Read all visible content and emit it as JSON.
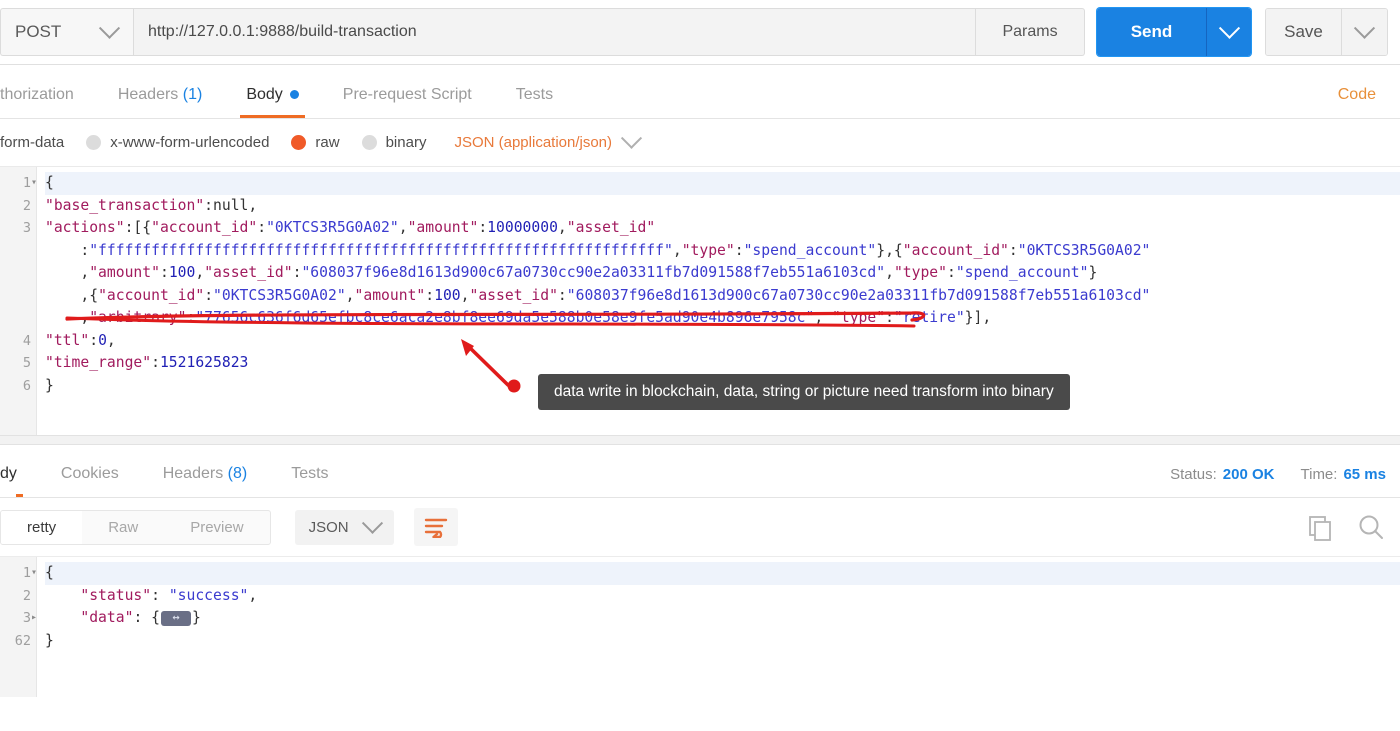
{
  "request_bar": {
    "method": "POST",
    "url": "http://127.0.0.1:9888/build-transaction",
    "params_label": "Params",
    "send_label": "Send",
    "save_label": "Save"
  },
  "request_tabs": {
    "items": [
      {
        "label": "thorization",
        "count": "",
        "active": false
      },
      {
        "label": "Headers",
        "count": "(1)",
        "active": false
      },
      {
        "label": "Body",
        "count": "",
        "active": true
      },
      {
        "label": "Pre-request Script",
        "count": "",
        "active": false
      },
      {
        "label": "Tests",
        "count": "",
        "active": false
      }
    ],
    "code_link": "Code"
  },
  "body_type": {
    "options": [
      {
        "label": "form-data",
        "selected": false,
        "has_radio": false
      },
      {
        "label": "x-www-form-urlencoded",
        "selected": false,
        "has_radio": true
      },
      {
        "label": "raw",
        "selected": true,
        "has_radio": true
      },
      {
        "label": "binary",
        "selected": false,
        "has_radio": true
      }
    ],
    "format": "JSON (application/json)"
  },
  "request_body": {
    "line_numbers": [
      "1",
      "2",
      "3",
      "",
      "",
      "",
      "",
      "4",
      "5",
      "6"
    ],
    "lines": [
      {
        "n": "1",
        "fold": true,
        "segments": [
          {
            "t": "{",
            "c": "p"
          }
        ]
      },
      {
        "n": "2",
        "segments": [
          {
            "t": "\"base_transaction\"",
            "c": "k"
          },
          {
            "t": ":",
            "c": "p"
          },
          {
            "t": "null",
            "c": "nul"
          },
          {
            "t": ",",
            "c": "p"
          }
        ]
      },
      {
        "n": "3",
        "segments": [
          {
            "t": "\"actions\"",
            "c": "k"
          },
          {
            "t": ":[{",
            "c": "p"
          },
          {
            "t": "\"account_id\"",
            "c": "k"
          },
          {
            "t": ":",
            "c": "p"
          },
          {
            "t": "\"0KTCS3R5G0A02\"",
            "c": "s"
          },
          {
            "t": ",",
            "c": "p"
          },
          {
            "t": "\"amount\"",
            "c": "k"
          },
          {
            "t": ":",
            "c": "p"
          },
          {
            "t": "10000000",
            "c": "n"
          },
          {
            "t": ",",
            "c": "p"
          },
          {
            "t": "\"asset_id\"",
            "c": "k"
          }
        ]
      },
      {
        "n": "",
        "indent": 4,
        "segments": [
          {
            "t": ":",
            "c": "p"
          },
          {
            "t": "\"ffffffffffffffffffffffffffffffffffffffffffffffffffffffffffffffff\"",
            "c": "s"
          },
          {
            "t": ",",
            "c": "p"
          },
          {
            "t": "\"type\"",
            "c": "k"
          },
          {
            "t": ":",
            "c": "p"
          },
          {
            "t": "\"spend_account\"",
            "c": "s"
          },
          {
            "t": "},{",
            "c": "p"
          },
          {
            "t": "\"account_id\"",
            "c": "k"
          },
          {
            "t": ":",
            "c": "p"
          },
          {
            "t": "\"0KTCS3R5G0A02\"",
            "c": "s"
          }
        ]
      },
      {
        "n": "",
        "indent": 4,
        "segments": [
          {
            "t": ",",
            "c": "p"
          },
          {
            "t": "\"amount\"",
            "c": "k"
          },
          {
            "t": ":",
            "c": "p"
          },
          {
            "t": "100",
            "c": "n"
          },
          {
            "t": ",",
            "c": "p"
          },
          {
            "t": "\"asset_id\"",
            "c": "k"
          },
          {
            "t": ":",
            "c": "p"
          },
          {
            "t": "\"608037f96e8d1613d900c67a0730cc90e2a03311fb7d091588f7eb551a6103cd\"",
            "c": "s"
          },
          {
            "t": ",",
            "c": "p"
          },
          {
            "t": "\"type\"",
            "c": "k"
          },
          {
            "t": ":",
            "c": "p"
          },
          {
            "t": "\"spend_account\"",
            "c": "s"
          },
          {
            "t": "}",
            "c": "p"
          }
        ]
      },
      {
        "n": "",
        "indent": 4,
        "segments": [
          {
            "t": ",{",
            "c": "p"
          },
          {
            "t": "\"account_id\"",
            "c": "k"
          },
          {
            "t": ":",
            "c": "p"
          },
          {
            "t": "\"0KTCS3R5G0A02\"",
            "c": "s"
          },
          {
            "t": ",",
            "c": "p"
          },
          {
            "t": "\"amount\"",
            "c": "k"
          },
          {
            "t": ":",
            "c": "p"
          },
          {
            "t": "100",
            "c": "n"
          },
          {
            "t": ",",
            "c": "p"
          },
          {
            "t": "\"asset_id\"",
            "c": "k"
          },
          {
            "t": ":",
            "c": "p"
          },
          {
            "t": "\"608037f96e8d1613d900c67a0730cc90e2a03311fb7d091588f7eb551a6103cd\"",
            "c": "s"
          }
        ]
      },
      {
        "n": "",
        "indent": 4,
        "segments": [
          {
            "t": ",",
            "c": "p"
          },
          {
            "t": "\"arbitrary\"",
            "c": "k"
          },
          {
            "t": ":",
            "c": "p"
          },
          {
            "t": "\"77656c636f6d65efbc8ce6aca2e8bf8ee69da5e588b0e58e9fe5ad90e4b896e7958c\"",
            "c": "s"
          },
          {
            "t": ", ",
            "c": "p"
          },
          {
            "t": "\"type\"",
            "c": "k"
          },
          {
            "t": ":",
            "c": "p"
          },
          {
            "t": "\"retire\"",
            "c": "s"
          },
          {
            "t": "}],",
            "c": "p"
          }
        ]
      },
      {
        "n": "4",
        "segments": [
          {
            "t": "\"ttl\"",
            "c": "k"
          },
          {
            "t": ":",
            "c": "p"
          },
          {
            "t": "0",
            "c": "n"
          },
          {
            "t": ",",
            "c": "p"
          }
        ]
      },
      {
        "n": "5",
        "segments": [
          {
            "t": "\"time_range\"",
            "c": "k"
          },
          {
            "t": ":",
            "c": "p"
          },
          {
            "t": "1521625823",
            "c": "n"
          }
        ]
      },
      {
        "n": "6",
        "segments": [
          {
            "t": "}",
            "c": "p"
          }
        ]
      }
    ]
  },
  "annotation": {
    "tooltip_text": "data write in blockchain,  data, string or picture need transform into binary",
    "underline_color": "#e01b1b",
    "arrow_color": "#e01b1b",
    "tooltip_bg": "#4a4a4a"
  },
  "response_tabs": {
    "items": [
      {
        "label": "dy",
        "count": "",
        "active": true
      },
      {
        "label": "Cookies",
        "count": "",
        "active": false
      },
      {
        "label": "Headers",
        "count": "(8)",
        "active": false
      },
      {
        "label": "Tests",
        "count": "",
        "active": false
      }
    ],
    "status_label": "Status:",
    "status_value": "200 OK",
    "time_label": "Time:",
    "time_value": "65 ms"
  },
  "response_toolbar": {
    "view_modes": [
      {
        "label": "retty",
        "active": true
      },
      {
        "label": "Raw",
        "active": false
      },
      {
        "label": "Preview",
        "active": false
      }
    ],
    "format": "JSON",
    "wrap_icon": "word-wrap-icon",
    "copy_icon": "copy-icon",
    "search_icon": "search-icon"
  },
  "response_body": {
    "lines": [
      {
        "n": "1",
        "fold": true,
        "segments": [
          {
            "t": "{",
            "c": "p"
          }
        ]
      },
      {
        "n": "2",
        "indent": 4,
        "segments": [
          {
            "t": "\"status\"",
            "c": "k"
          },
          {
            "t": ": ",
            "c": "p"
          },
          {
            "t": "\"success\"",
            "c": "s"
          },
          {
            "t": ",",
            "c": "p"
          }
        ]
      },
      {
        "n": "3",
        "fold_right": true,
        "indent": 4,
        "segments": [
          {
            "t": "\"data\"",
            "c": "k"
          },
          {
            "t": ": {",
            "c": "p"
          },
          {
            "t": "__CHIP__",
            "c": "chip"
          },
          {
            "t": "}",
            "c": "p"
          }
        ]
      },
      {
        "n": "62",
        "segments": [
          {
            "t": "}",
            "c": "p"
          }
        ]
      }
    ]
  },
  "colors": {
    "accent_orange": "#ef6c24",
    "accent_blue": "#1a82e2",
    "string_blue": "#3b3bcf",
    "key_magenta": "#a11b5e",
    "annotation_red": "#e01b1b"
  }
}
